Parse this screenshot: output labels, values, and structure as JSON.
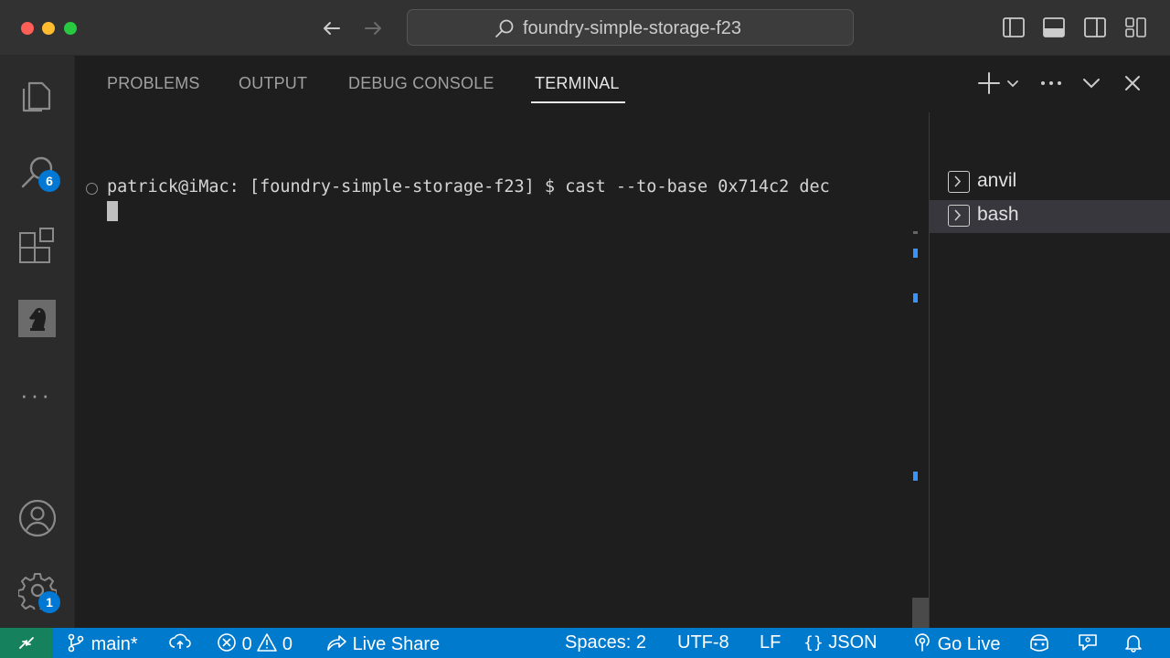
{
  "window": {
    "title": "foundry-simple-storage-f23"
  },
  "activity_bar": {
    "search_badge": "6",
    "settings_badge": "1",
    "more": "···"
  },
  "panel": {
    "tabs": [
      {
        "label": "PROBLEMS",
        "active": false
      },
      {
        "label": "OUTPUT",
        "active": false
      },
      {
        "label": "DEBUG CONSOLE",
        "active": false
      },
      {
        "label": "TERMINAL",
        "active": true
      }
    ]
  },
  "terminal": {
    "prompt_line": "patrick@iMac: [foundry-simple-storage-f23] $ cast --to-base 0x714c2 dec",
    "instances": [
      {
        "name": "anvil",
        "selected": false
      },
      {
        "name": "bash",
        "selected": true
      }
    ]
  },
  "status_bar": {
    "branch": "main*",
    "errors": "0",
    "warnings": "0",
    "live_share": "Live Share",
    "spaces": "Spaces: 2",
    "encoding": "UTF-8",
    "eol": "LF",
    "language": "JSON",
    "go_live": "Go Live"
  },
  "colors": {
    "status_bar": "#007acc",
    "remote_indicator": "#16825d",
    "badge": "#0078d4",
    "scroll_marker": "#3794ff"
  }
}
